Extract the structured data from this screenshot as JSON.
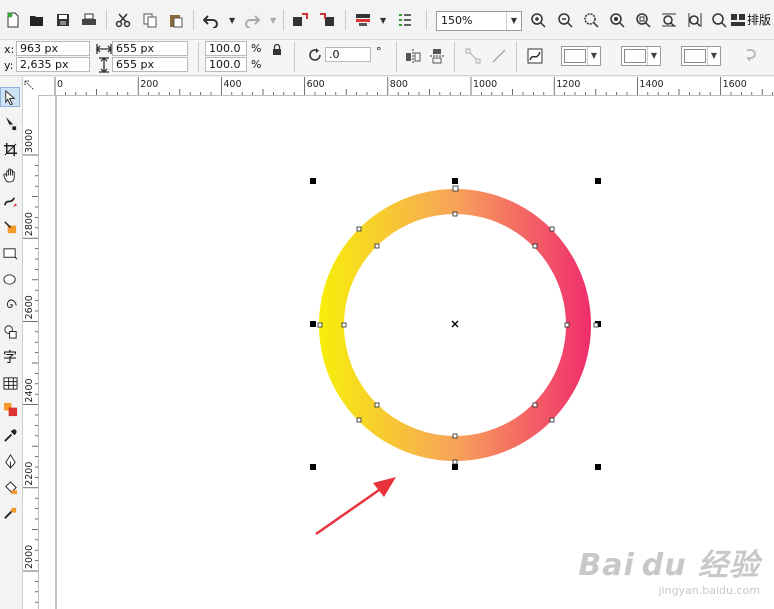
{
  "toolbar": {
    "zoom": "150%",
    "layout_label": "排版"
  },
  "properties": {
    "x_label": "x:",
    "x_value": "963 px",
    "y_label": "y:",
    "y_value": "2,635 px",
    "width_value": "655 px",
    "height_value": "655 px",
    "scale_x": "100.0",
    "scale_y": "100.0",
    "percent": "%",
    "angle_value": ".0",
    "degree": "°"
  },
  "rulers": {
    "horizontal": [
      "0",
      "200",
      "400",
      "600",
      "800",
      "1000",
      "1200",
      "1400",
      "1600"
    ],
    "vertical": [
      "3000",
      "2800",
      "2600",
      "2400",
      "2200",
      "2000"
    ]
  },
  "toolbox_text_tool": "字",
  "colors": {
    "gradient_start": "#f7ef0a",
    "gradient_mid": "#f7a35a",
    "gradient_end": "#ef2d6d",
    "arrow": "#e8323c"
  },
  "watermark": {
    "brand": "Bai du 经验",
    "url": "jingyan.baidu.com"
  }
}
